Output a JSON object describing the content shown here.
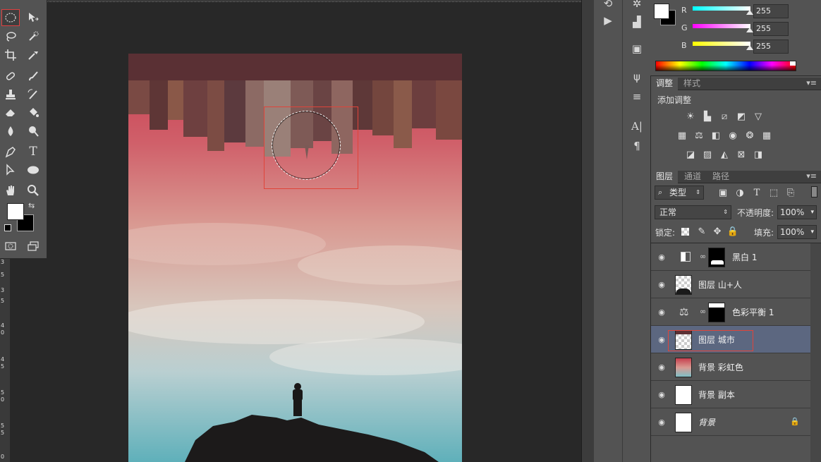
{
  "toolbox": {
    "tools": [
      "elliptical-marquee",
      "move",
      "lasso",
      "quick-selection",
      "crop",
      "eyedropper",
      "spot-healing-brush",
      "brush",
      "clone-stamp",
      "history-brush",
      "eraser",
      "paint-bucket",
      "blur",
      "dodge",
      "pen",
      "type",
      "path-selection",
      "ellipse-shape",
      "hand",
      "zoom"
    ],
    "colors": {
      "foreground": "#ffffff",
      "background": "#000000"
    }
  },
  "ruler": {
    "ticks": [
      "3",
      "5",
      "3",
      "5",
      "4",
      "0",
      "4",
      "5",
      "5",
      "0",
      "5",
      "5",
      "0"
    ]
  },
  "canvas": {
    "colors": {
      "sky_top": "#c8404f",
      "sky_mid": "#d89a94",
      "sky_bottom": "#6fb9c2"
    }
  },
  "color_panel": {
    "channels": [
      {
        "label": "R",
        "value": "255",
        "color": "#00ffff"
      },
      {
        "label": "G",
        "value": "255",
        "color": "#ff00ff"
      },
      {
        "label": "B",
        "value": "255",
        "color": "#ffff00"
      }
    ]
  },
  "adjustments": {
    "tabs": [
      "调整",
      "样式"
    ],
    "title": "添加调整",
    "icons": [
      "brightness-icon",
      "levels-icon",
      "curves-icon",
      "exposure-icon",
      "vibrance-icon",
      "hue-saturation-icon",
      "color-balance-icon",
      "black-white-icon",
      "photo-filter-icon",
      "channel-mixer-icon",
      "color-lookup-icon",
      "invert-icon",
      "posterize-icon",
      "threshold-icon",
      "selective-color-icon",
      "gradient-map-icon"
    ]
  },
  "layers": {
    "tabs": [
      "图层",
      "通道",
      "路径"
    ],
    "filter": "类型",
    "blend_mode": "正常",
    "opacity_label": "不透明度:",
    "opacity": "100%",
    "lock_label": "锁定:",
    "fill_label": "填充:",
    "fill": "100%",
    "items": [
      {
        "name": "黑白 1"
      },
      {
        "name": "图层 山+人"
      },
      {
        "name": "色彩平衡 1"
      },
      {
        "name": "图层 城市"
      },
      {
        "name": "背景 彩虹色"
      },
      {
        "name": "背景 副本"
      },
      {
        "name": "背景"
      }
    ]
  }
}
